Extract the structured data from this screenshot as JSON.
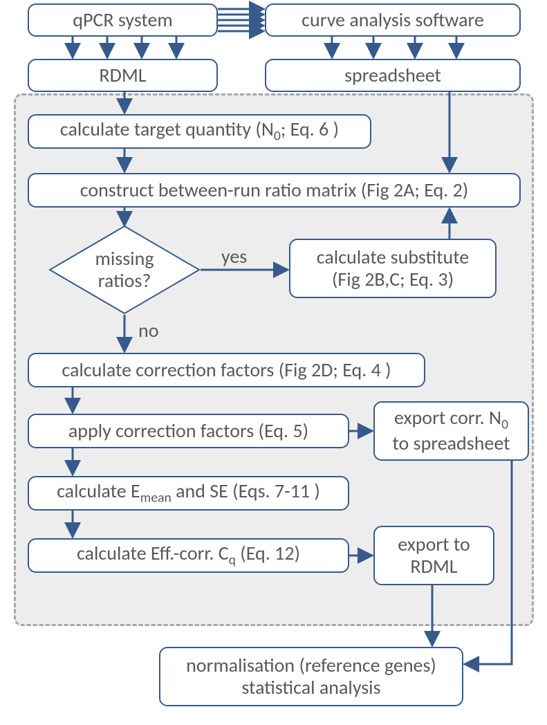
{
  "chart_data": {
    "type": "diagram",
    "description": "Flowchart of qPCR data processing workflow",
    "nodes": [
      {
        "id": "qpcr",
        "type": "process",
        "label": "qPCR system"
      },
      {
        "id": "curve_sw",
        "type": "process",
        "label": "curve analysis software"
      },
      {
        "id": "rdml",
        "type": "process",
        "label": "RDML"
      },
      {
        "id": "spreadsheet",
        "type": "process",
        "label": "spreadsheet"
      },
      {
        "id": "calc_n0",
        "type": "process",
        "label": "calculate target quantity (N₀; Eq. 6 )"
      },
      {
        "id": "matrix",
        "type": "process",
        "label": "construct between-run ratio matrix (Fig 2A; Eq. 2)"
      },
      {
        "id": "missing",
        "type": "decision",
        "label": "missing ratios?"
      },
      {
        "id": "substitute",
        "type": "process",
        "label": "calculate substitute (Fig 2B,C; Eq. 3)"
      },
      {
        "id": "calc_corr",
        "type": "process",
        "label": "calculate correction factors (Fig 2D; Eq. 4 )"
      },
      {
        "id": "apply_corr",
        "type": "process",
        "label": "apply correction factors (Eq.  5)"
      },
      {
        "id": "export_n0",
        "type": "output",
        "label": "export corr. N₀ to spreadsheet"
      },
      {
        "id": "emean",
        "type": "process",
        "label": "calculate Eₘₑₐₙ and SE (Eqs. 7-11 )"
      },
      {
        "id": "eff_cq",
        "type": "process",
        "label": "calculate Eff.-corr. Cq (Eq. 12)"
      },
      {
        "id": "export_rdml",
        "type": "output",
        "label": "export to RDML"
      },
      {
        "id": "final",
        "type": "process",
        "label": "normalisation (reference genes) statistical analysis"
      }
    ],
    "edges": [
      {
        "from": "qpcr",
        "to": "rdml"
      },
      {
        "from": "qpcr",
        "to": "curve_sw"
      },
      {
        "from": "curve_sw",
        "to": "spreadsheet"
      },
      {
        "from": "rdml",
        "to": "calc_n0"
      },
      {
        "from": "spreadsheet",
        "to": "matrix"
      },
      {
        "from": "calc_n0",
        "to": "matrix"
      },
      {
        "from": "matrix",
        "to": "missing"
      },
      {
        "from": "missing",
        "to": "substitute",
        "label": "yes"
      },
      {
        "from": "substitute",
        "to": "matrix"
      },
      {
        "from": "missing",
        "to": "calc_corr",
        "label": "no"
      },
      {
        "from": "calc_corr",
        "to": "apply_corr"
      },
      {
        "from": "apply_corr",
        "to": "export_n0"
      },
      {
        "from": "apply_corr",
        "to": "emean"
      },
      {
        "from": "emean",
        "to": "eff_cq"
      },
      {
        "from": "eff_cq",
        "to": "export_rdml"
      },
      {
        "from": "export_rdml",
        "to": "final"
      },
      {
        "from": "export_n0",
        "to": "final"
      }
    ]
  },
  "nodes": {
    "qpcr": "qPCR system",
    "curve_sw": "curve analysis software",
    "rdml": "RDML",
    "spreadsheet": "spreadsheet",
    "calc_n0_a": "calculate target quantity (N",
    "calc_n0_b": "; Eq. 6 )",
    "matrix": "construct between-run ratio matrix (Fig 2A; Eq. 2)",
    "missing_a": "missing",
    "missing_b": "ratios?",
    "substitute_a": "calculate substitute",
    "substitute_b": "(Fig 2B,C; Eq. 3)",
    "calc_corr": "calculate correction factors (Fig 2D; Eq. 4 )",
    "apply_corr": "apply correction factors (Eq.  5)",
    "export_n0_a": "export corr. N",
    "export_n0_b": "to spreadsheet",
    "emean_a": "calculate E",
    "emean_b": " and SE (Eqs. 7-11 )",
    "eff_cq_a": "calculate Eff.-corr. C",
    "eff_cq_b": " (Eq. 12)",
    "export_rdml_a": "export to",
    "export_rdml_b": "RDML",
    "final_a": "normalisation (reference genes)",
    "final_b": "statistical analysis"
  },
  "labels": {
    "yes": "yes",
    "no": "no",
    "sub0": "0",
    "sub_mean": "mean",
    "sub_q": "q"
  }
}
